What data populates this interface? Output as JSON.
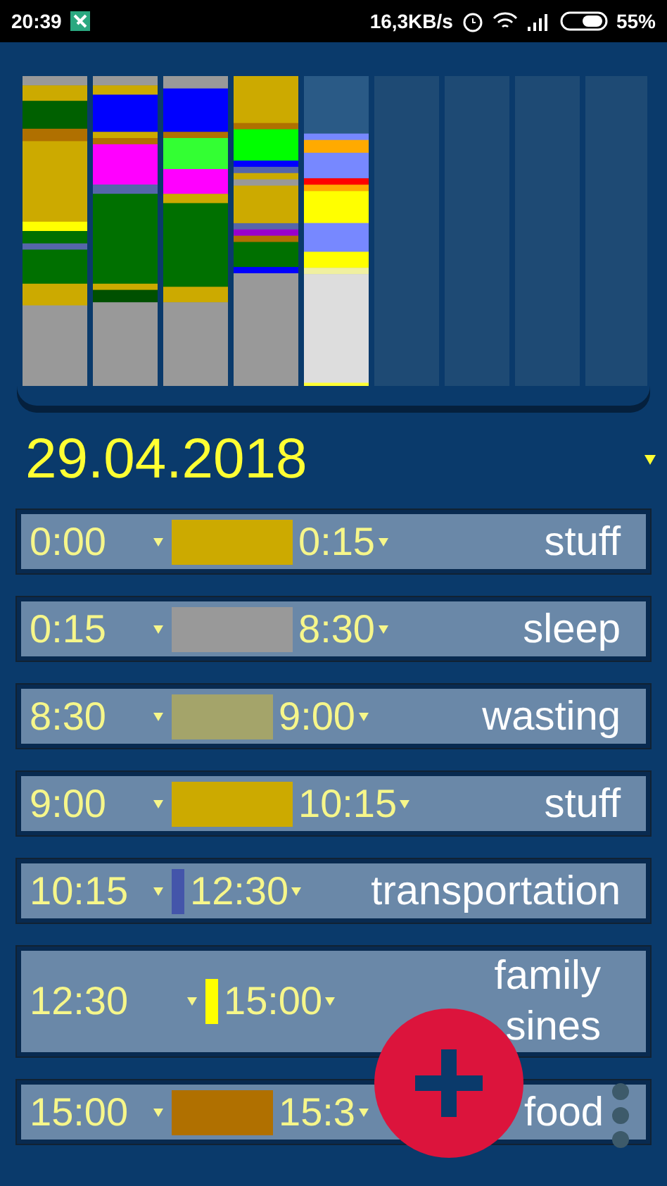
{
  "status_bar": {
    "time": "20:39",
    "speed": "16,3KB/s",
    "battery": "55%"
  },
  "date": {
    "label": "29.04.2018"
  },
  "entries": [
    {
      "start": "0:00",
      "end": "0:15",
      "category": [
        "stuff"
      ],
      "color": "#ccaa00",
      "kind": "wide"
    },
    {
      "start": "0:15",
      "end": "8:30",
      "category": [
        "sleep"
      ],
      "color": "#999999",
      "kind": "wide"
    },
    {
      "start": "8:30",
      "end": "9:00",
      "category": [
        "wasting"
      ],
      "color": "#a4a46a",
      "kind": "medium"
    },
    {
      "start": "9:00",
      "end": "10:15",
      "category": [
        "stuff"
      ],
      "color": "#ccaa00",
      "kind": "wide"
    },
    {
      "start": "10:15",
      "end": "12:30",
      "category": [
        "transportation"
      ],
      "color": "#4455aa",
      "kind": "narrow"
    },
    {
      "start": "12:30",
      "end": "15:00",
      "category": [
        "family",
        "sines"
      ],
      "color": "#ffff00",
      "kind": "narrow"
    },
    {
      "start": "15:00",
      "end": "15:3",
      "category": [
        "food"
      ],
      "color": "#b07000",
      "kind": "medium"
    }
  ]
}
